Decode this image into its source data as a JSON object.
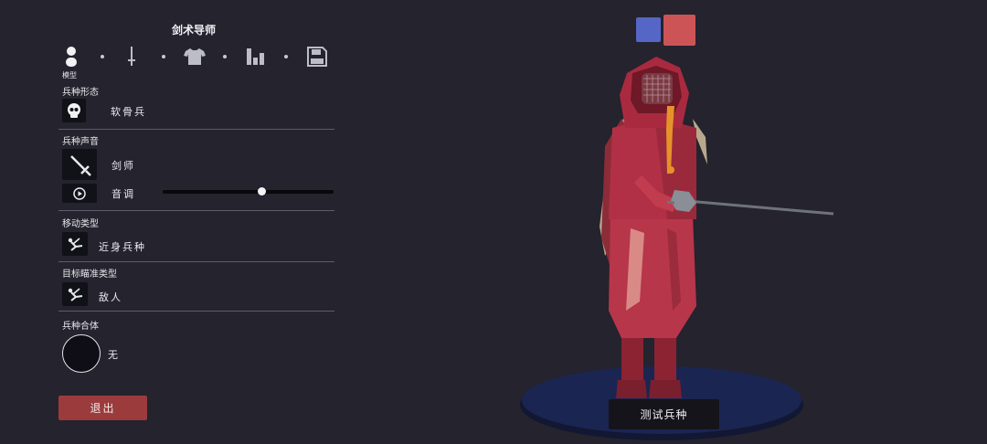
{
  "panel": {
    "title": "剑术导师",
    "steps": [
      {
        "name": "model",
        "icon": "person-icon",
        "label": "模型",
        "active": true
      },
      {
        "name": "weapon",
        "icon": "sword-icon",
        "active": false
      },
      {
        "name": "clothing",
        "icon": "shirt-icon",
        "active": false
      },
      {
        "name": "stats",
        "icon": "bar-chart-icon",
        "active": false
      },
      {
        "name": "save",
        "icon": "save-icon",
        "active": false
      }
    ],
    "sections": {
      "unit_form": {
        "label": "兵种形态",
        "value": "软骨兵",
        "icon": "skull-icon"
      },
      "unit_voice": {
        "label": "兵种声音",
        "value": "剑师",
        "icon": "sword-icon",
        "pitch_label": "音调",
        "pitch_icon": "play-icon",
        "pitch_value": 0.58
      },
      "movement_type": {
        "label": "移动类型",
        "value": "近身兵种",
        "icon": "melee-icon"
      },
      "targeting_type": {
        "label": "目标瞄准类型",
        "value": "敌人",
        "icon": "melee-icon"
      },
      "unit_combine": {
        "label": "兵种合体",
        "value": "无"
      }
    },
    "exit_label": "退出"
  },
  "preview": {
    "colors": [
      {
        "name": "blue",
        "hex": "#5566c6"
      },
      {
        "name": "red",
        "hex": "#cd5456"
      }
    ],
    "test_label": "测试兵种"
  }
}
